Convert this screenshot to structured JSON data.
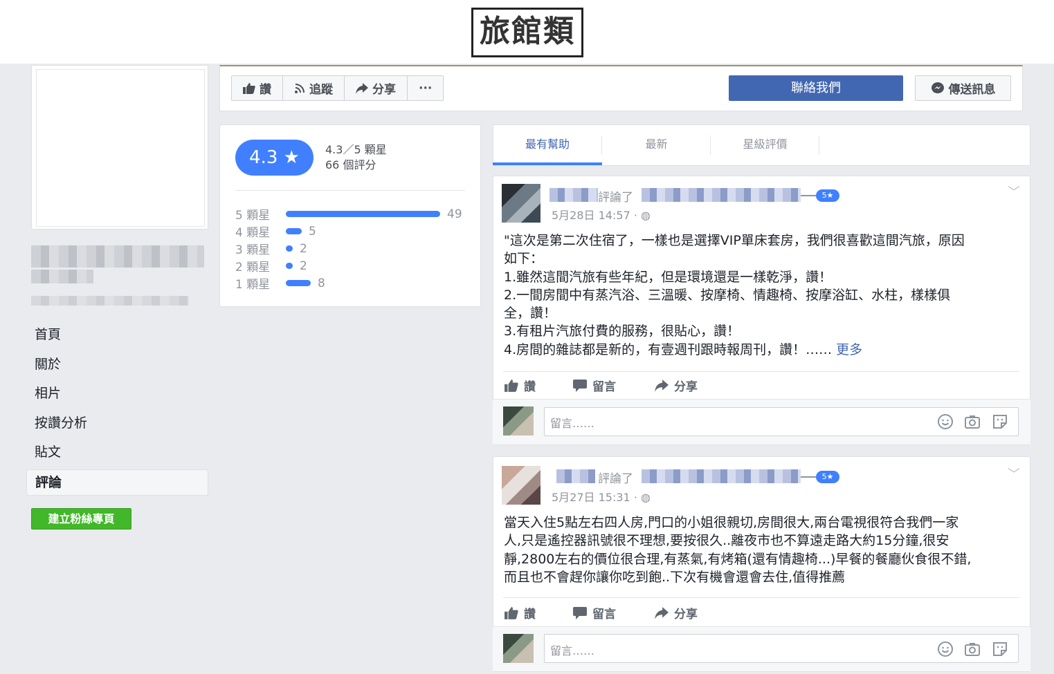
{
  "banner": {
    "title": "旅館類"
  },
  "sidebar": {
    "nav": [
      "首頁",
      "關於",
      "相片",
      "按讚分析",
      "貼文",
      "評論"
    ],
    "create_page": "建立粉絲專頁"
  },
  "action_bar": {
    "like": "讚",
    "follow": "追蹤",
    "share": "分享",
    "more": "···",
    "contact": "聯絡我們",
    "message": "傳送訊息"
  },
  "rating": {
    "score": "4.3",
    "star": "★",
    "summary_line1": "4.3／5 顆星",
    "summary_line2": "66 個評分",
    "rows": [
      {
        "label": "5 顆星",
        "count": "49",
        "fraction": 0.98
      },
      {
        "label": "4 顆星",
        "count": "5",
        "fraction": 0.1
      },
      {
        "label": "3 顆星",
        "count": "2",
        "fraction": 0.04
      },
      {
        "label": "2 顆星",
        "count": "2",
        "fraction": 0.04
      },
      {
        "label": "1 顆星",
        "count": "8",
        "fraction": 0.16
      }
    ]
  },
  "tabs": [
    "最有幫助",
    "最新",
    "星級評價"
  ],
  "reviews": [
    {
      "commented": "評論了",
      "stars": "5★",
      "time": "5月28日 14:57 · ",
      "body": "\"這次是第二次住宿了，一樣也是選擇VIP單床套房，我們很喜歡這間汽旅，原因\n如下：\n1.雖然這間汽旅有些年紀，但是環境還是一樣乾淨，讚！\n2.一間房間中有蒸汽浴、三溫暖、按摩椅、情趣椅、按摩浴缸、水柱，樣樣俱\n全，讚！\n3.有租片汽旅付費的服務，很貼心，讚！\n4.房間的雜誌都是新的，有壹週刊跟時報周刊，讚！……",
      "more": " 更多"
    },
    {
      "commented": "評論了",
      "stars": "5★",
      "time": "5月27日 15:31 · ",
      "body": "當天入住5點左右四人房,門口的小姐很親切,房間很大,兩台電視很符合我們一家\n人,只是遙控器訊號很不理想,要按很久..離夜市也不算遠走路大約15分鐘,很安\n靜,2800左右的價位很合理,有蒸氣,有烤箱(還有情趣椅...)早餐的餐廳伙食很不錯,\n而且也不會趕你讓你吃到飽..下次有機會還會去住,值得推薦"
    }
  ],
  "review_actions": {
    "like": "讚",
    "comment": "留言",
    "share": "分享"
  },
  "comment_box": {
    "placeholder": "留言……"
  }
}
